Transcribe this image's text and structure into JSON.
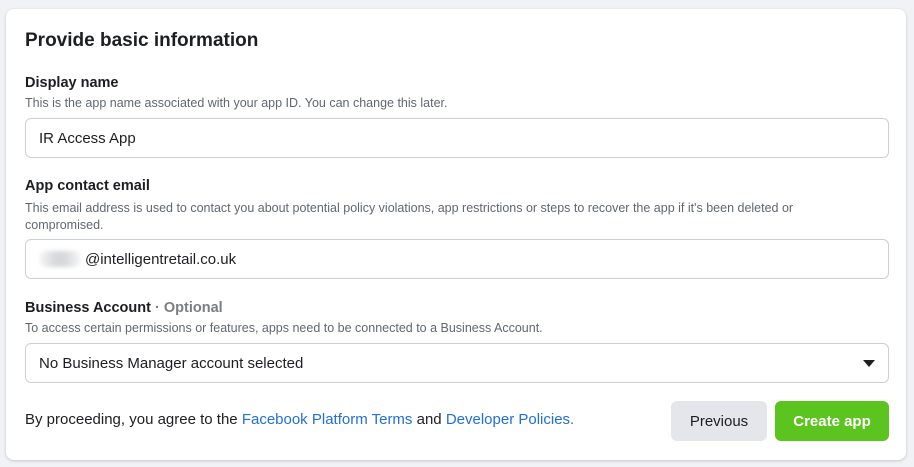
{
  "form": {
    "title": "Provide basic information",
    "display_name": {
      "label": "Display name",
      "help": "This is the app name associated with your app ID. You can change this later.",
      "value": "IR Access App"
    },
    "contact_email": {
      "label": "App contact email",
      "help": "This email address is used to contact you about potential policy violations, app restrictions or steps to recover the app if it's been deleted or compromised.",
      "value_suffix": "@intelligentretail.co.uk"
    },
    "business_account": {
      "label": "Business Account",
      "optional": "· Optional",
      "help": "To access certain permissions or features, apps need to be connected to a Business Account.",
      "selected": "No Business Manager account selected",
      "icon": "caret-down-icon"
    }
  },
  "footer": {
    "agree_prefix": "By proceeding, you agree to the ",
    "terms_link": "Facebook Platform Terms",
    "and_text": " and ",
    "policies_link": "Developer Policies.",
    "previous_label": "Previous",
    "create_label": "Create app"
  },
  "colors": {
    "primary_button": "#5cc41f",
    "link": "#216fdb",
    "secondary_button": "#e4e6eb"
  }
}
